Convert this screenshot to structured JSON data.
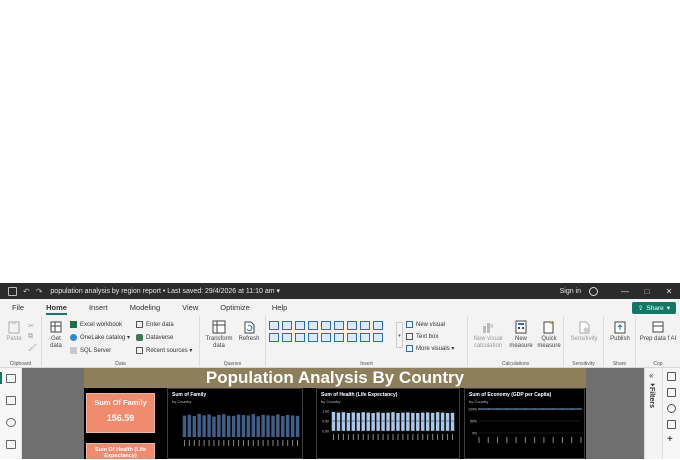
{
  "titlebar": {
    "title": "population analysis by region report",
    "last_saved": "Last saved: 29/4/2026 at 11:10 am",
    "sign_in": "Sign in",
    "minimize": "—",
    "maximize": "□",
    "close": "✕"
  },
  "menu": {
    "tabs": [
      "File",
      "Home",
      "Insert",
      "Modeling",
      "View",
      "Optimize",
      "Help"
    ],
    "active": "Home",
    "share_label": "Share"
  },
  "ribbon": {
    "clipboard": {
      "label": "Clipboard",
      "paste": "Paste"
    },
    "data": {
      "label": "Data",
      "get_data": "Get data",
      "excel": "Excel workbook",
      "onelake": "OneLake catalog",
      "sql": "SQL Server",
      "enter_data": "Enter data",
      "dataverse": "Dataverse",
      "recent_sources": "Recent sources"
    },
    "queries": {
      "label": "Queries",
      "transform": "Transform data",
      "refresh": "Refresh"
    },
    "insert": {
      "label": "Insert",
      "new_visual": "New visual",
      "text_box": "Text box",
      "more_visuals": "More visuals"
    },
    "calculations": {
      "label": "Calculations",
      "new_visual_calc": "New visual calculation",
      "new_measure": "New measure",
      "quick_measure": "Quick measure"
    },
    "sensitivity": {
      "label": "Sensitivity",
      "button": "Sensitivity"
    },
    "share": {
      "label": "Share",
      "publish": "Publish"
    },
    "copilot": {
      "label": "Cop",
      "prep_data": "Prep data f AI"
    }
  },
  "report": {
    "title": "Population Analysis By Country",
    "card1": {
      "title": "Sum Of Family",
      "value": "156.59"
    },
    "card2": {
      "title": "Sum Of Health (Life Expectancy)"
    }
  },
  "chart_data": [
    {
      "type": "bar",
      "title": "Sum of Family",
      "subtitle": "by Country",
      "bar_count": 24,
      "values": [
        1.2,
        1.25,
        1.18,
        1.3,
        1.22,
        1.27,
        1.15,
        1.24,
        1.28,
        1.2,
        1.19,
        1.26,
        1.23,
        1.21,
        1.29,
        1.17,
        1.25,
        1.22,
        1.2,
        1.27,
        1.18,
        1.24,
        1.21,
        1.19
      ],
      "color": "#3f5f88"
    },
    {
      "type": "bar",
      "title": "Sum of Health (Life Expectancy)",
      "subtitle": "by Country",
      "ytick_labels": [
        "1.00",
        "0.50",
        "0.00"
      ],
      "values": [
        0.95,
        0.92,
        0.94,
        0.9,
        0.93,
        0.91,
        0.94,
        0.92,
        0.9,
        0.93,
        0.91,
        0.92,
        0.94,
        0.9,
        0.92,
        0.93,
        0.91,
        0.9,
        0.92,
        0.93,
        0.91,
        0.94,
        0.92,
        0.9,
        0.91
      ],
      "color": "#a9c8ea"
    },
    {
      "type": "line",
      "title": "Sum of Economy (GDP per Capita)",
      "subtitle": "by Country",
      "ytick_labels": [
        "100%",
        "50%",
        "0%"
      ],
      "values": [
        100,
        100,
        100,
        100,
        100,
        100,
        100,
        100,
        100,
        100,
        100,
        100
      ],
      "color": "#6fa8dc"
    }
  ],
  "filters": {
    "label": "Filters"
  }
}
